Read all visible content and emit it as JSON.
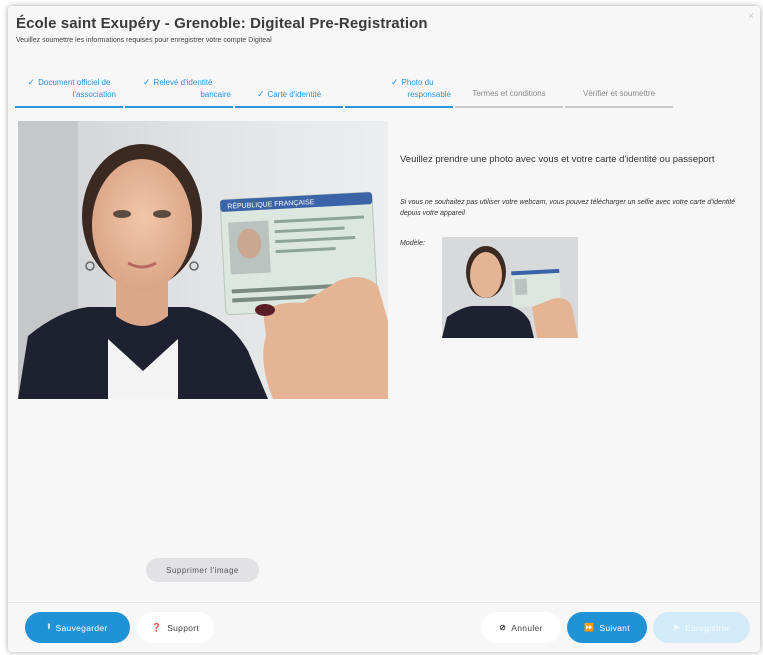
{
  "header": {
    "title": "École saint Exupéry - Grenoble: Digiteal Pre-Registration",
    "subtitle": "Veuillez soumettre les informations requises pour enregistrer votre compte Digiteal",
    "close_glyph": "×"
  },
  "steps": [
    {
      "line1": "Document officiel de",
      "line2": "l'association",
      "done": true
    },
    {
      "line1": "Relevé d'identité",
      "line2": "bancaire",
      "done": true
    },
    {
      "line1": "Carte d'identité",
      "line2": "",
      "done": true
    },
    {
      "line1": "Photo du",
      "line2": "responsable",
      "done": true
    },
    {
      "line1": "Termes et conditions",
      "line2": "",
      "done": false
    },
    {
      "line1": "Vérifier et soumettre",
      "line2": "",
      "done": false
    }
  ],
  "check_glyph": "✓",
  "main": {
    "instructions": "Veuillez prendre une photo avec vous et votre carte d'identité ou passeport",
    "note": "Si vous ne souhaitez pas utiliser votre webcam, vous pouvez télécharger un selfie avec votre carte d'identité depuis votre appareil",
    "model_label": "Modèle:",
    "id_card_header": "RÉPUBLIQUE FRANÇAISE",
    "delete_label": "Supprimer l'image"
  },
  "footer": {
    "save_label": "Sauvegarder",
    "support_label": "Support",
    "cancel_label": "Annuler",
    "next_label": "Suivant",
    "submit_label": "Enregistrer"
  },
  "icons": {
    "save": "upload-icon",
    "support": "question-circle-icon",
    "cancel": "ban-icon",
    "next": "forward-icon",
    "submit": "send-icon"
  },
  "colors": {
    "accent": "#2092d6",
    "step_active": "#2a95d9",
    "step_pending": "#c9c9c9",
    "disabled": "#d3ebf8"
  }
}
